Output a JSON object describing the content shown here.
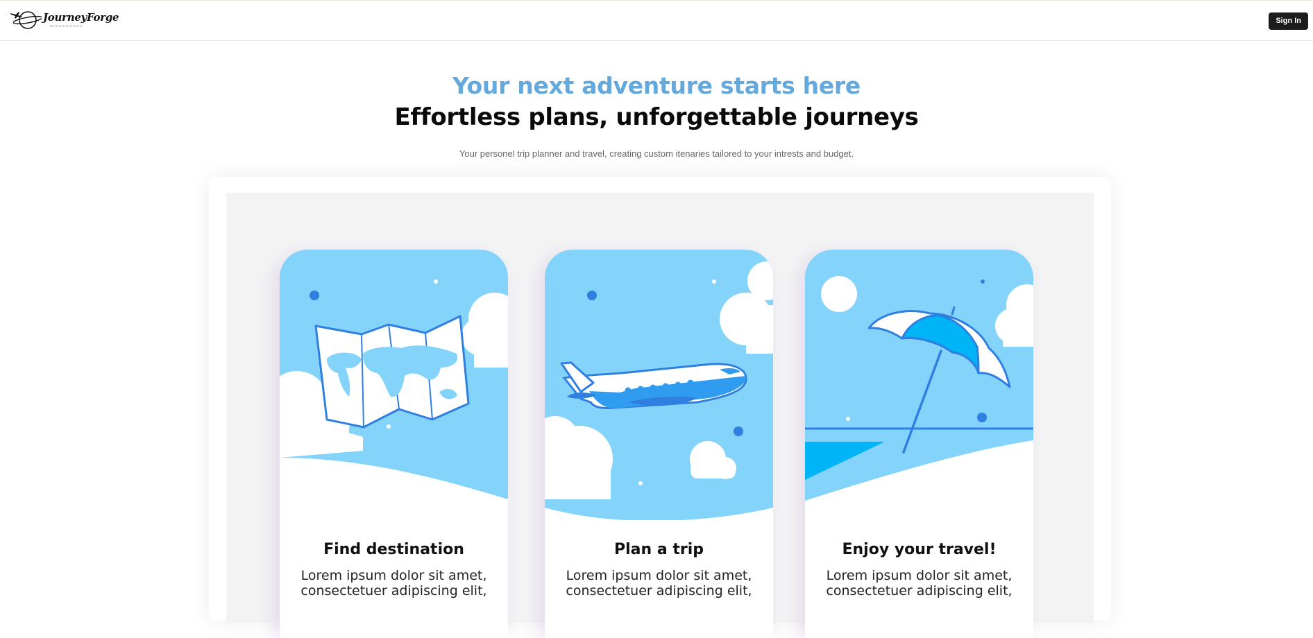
{
  "header": {
    "brand": "JourneyForge",
    "logo_icon": "plane-globe-logo",
    "signin_label": "Sign In"
  },
  "hero": {
    "tagline": "Your next adventure starts here",
    "headline": "Effortless plans, unforgettable journeys",
    "subtitle": "Your personel trip planner and travel, creating custom itenaries tailored to your intrests and budget."
  },
  "colors": {
    "tagline": "#65a9dc",
    "sky": "#84d3fb",
    "accent_blue": "#2f7fe0",
    "signin_bg": "#1c1c1c"
  },
  "cards": [
    {
      "title": "Find destination",
      "text": "Lorem ipsum dolor sit amet, consectetuer adipiscing elit,",
      "illustration": "map-illustration"
    },
    {
      "title": "Plan a trip",
      "text": "Lorem ipsum dolor sit amet, consectetuer adipiscing elit,",
      "illustration": "airplane-illustration"
    },
    {
      "title": "Enjoy your travel!",
      "text": "Lorem ipsum dolor sit amet, consectetuer adipiscing elit,",
      "illustration": "beach-umbrella-illustration"
    }
  ]
}
